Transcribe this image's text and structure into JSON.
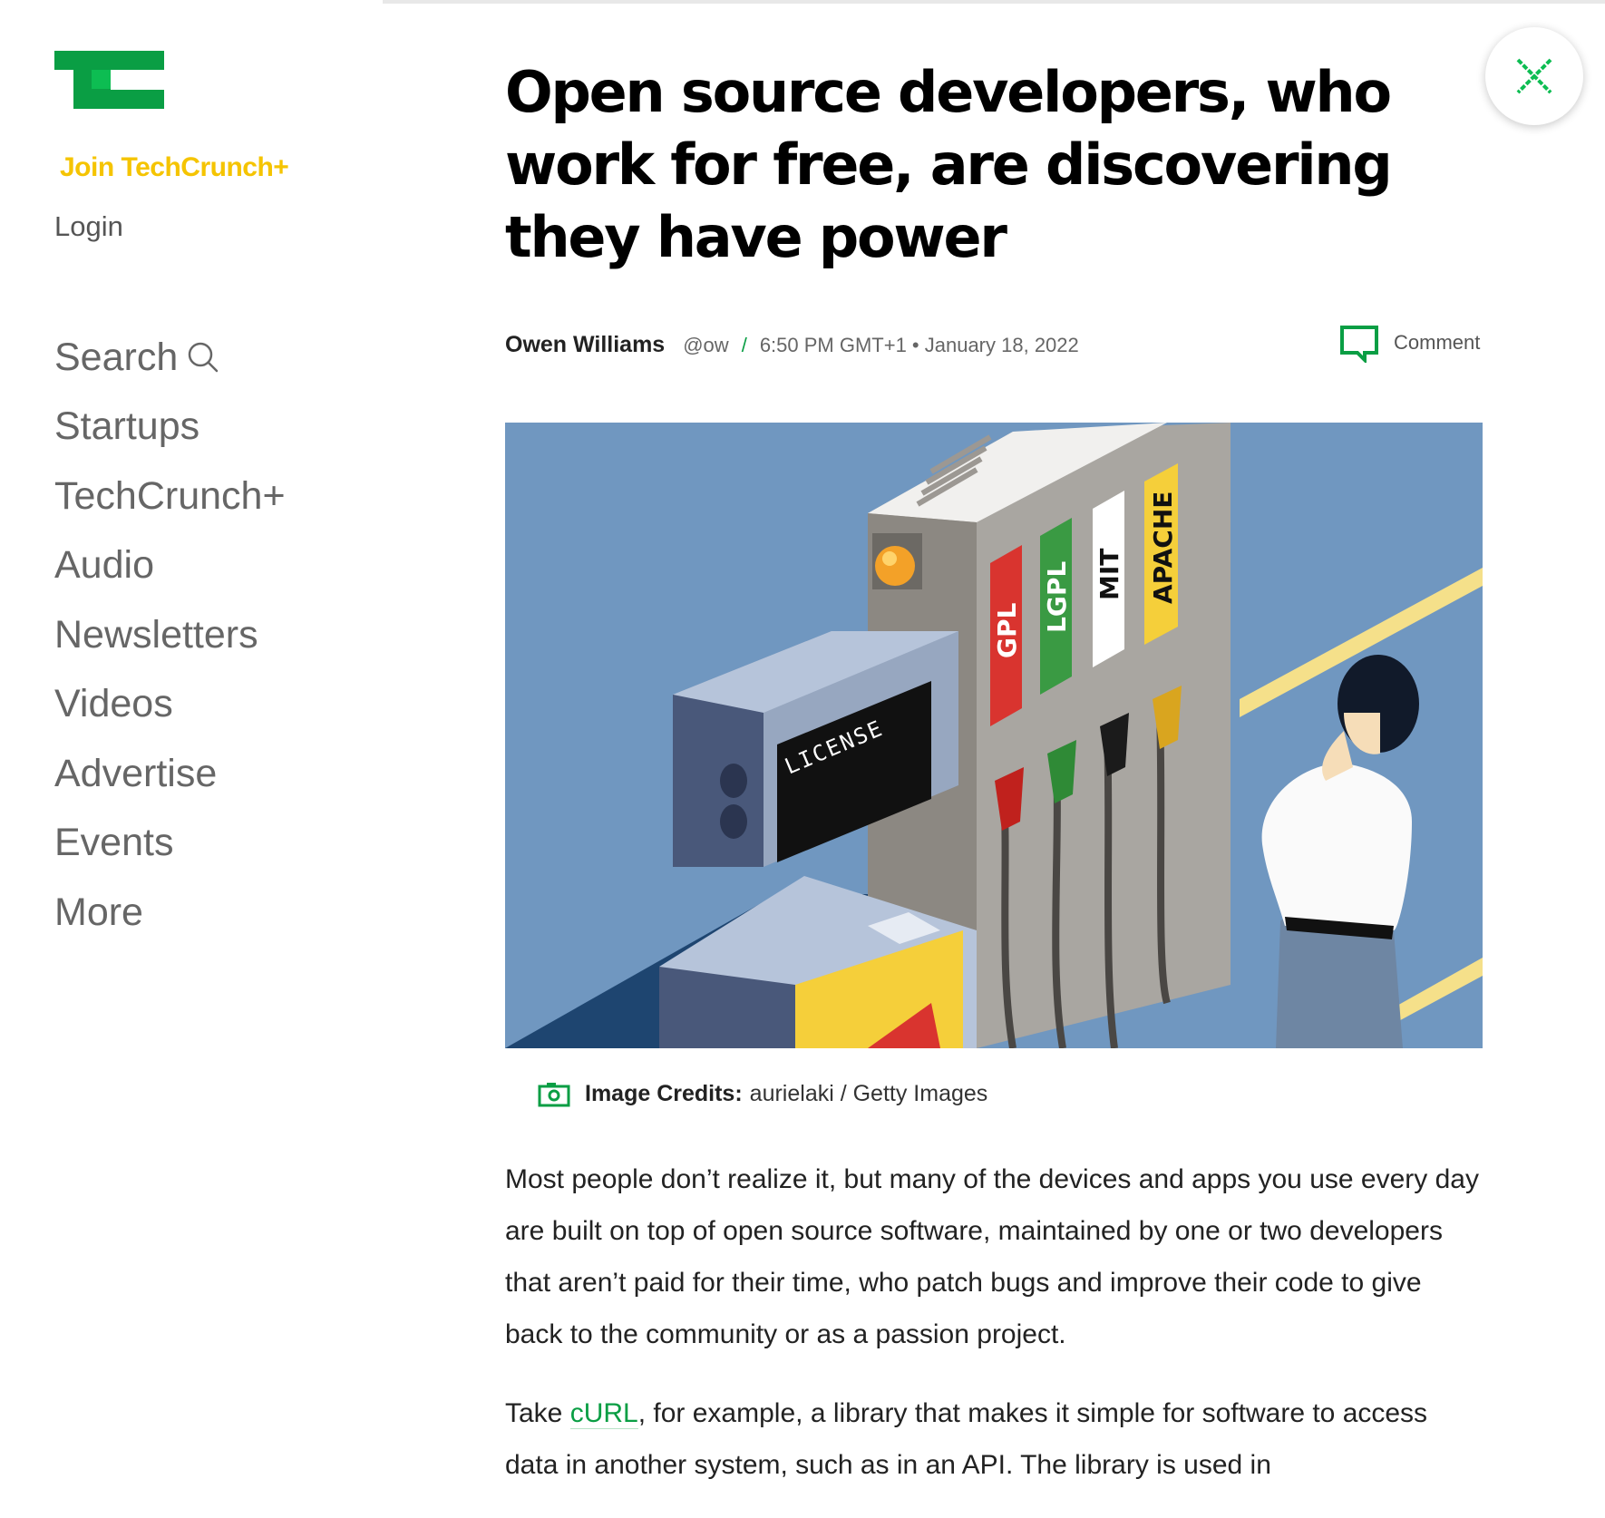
{
  "sidebar": {
    "join_label": "Join TechCrunch+",
    "login_label": "Login",
    "nav": {
      "search": "Search",
      "startups": "Startups",
      "techcrunch_plus": "TechCrunch+",
      "audio": "Audio",
      "newsletters": "Newsletters",
      "videos": "Videos",
      "advertise": "Advertise",
      "events": "Events",
      "more": "More"
    }
  },
  "article": {
    "headline": "Open source developers, who work for free, are discovering they have power",
    "author": "Owen Williams",
    "handle": "@ow",
    "separator": "/",
    "timestamp": "6:50 PM GMT+1 • January 18, 2022",
    "comment_label": "Comment",
    "image": {
      "labels": [
        "GPL",
        "LGPL",
        "MIT",
        "APACHE"
      ],
      "display_text": "LICENSE"
    },
    "credits_label": "Image Credits:",
    "credits_value": "aurielaki / Getty Images",
    "paragraph1": "Most people don’t realize it, but many of the devices and apps you use every day are built on top of open source software, maintained by one or two developers that aren’t paid for their time, who patch bugs and improve their code to give back to the community or as a passion project.",
    "paragraph2_before": "Take ",
    "paragraph2_link": "cURL",
    "paragraph2_after": ", for example, a library that makes it simple for software to access data in another system, such as in an API. The library is used in"
  },
  "colors": {
    "brand_green": "#0a9e44",
    "join_yellow": "#f5c400",
    "hero_background": "#7097c0"
  },
  "icons": [
    "techcrunch-logo",
    "search-icon",
    "comment-icon",
    "camera-icon",
    "close-icon"
  ]
}
